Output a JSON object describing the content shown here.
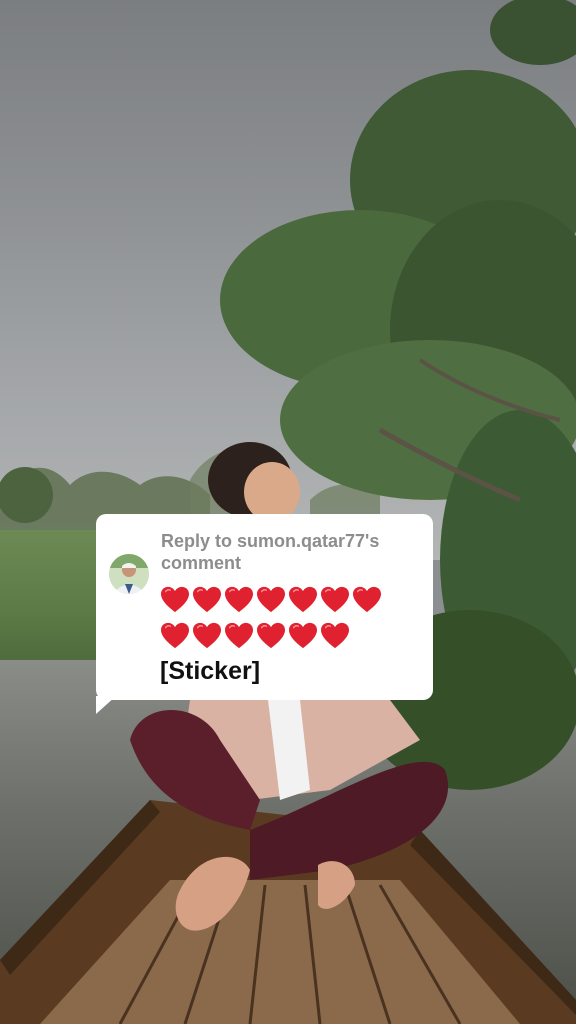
{
  "reply_card": {
    "header": "Reply to sumon.qatar77's comment",
    "heart_rows": [
      7,
      6
    ],
    "heart_icon": "red-heart-emoji",
    "heart_color": "#e0212f",
    "sticker_label": "[Sticker]",
    "avatar_icon": "user-avatar"
  }
}
